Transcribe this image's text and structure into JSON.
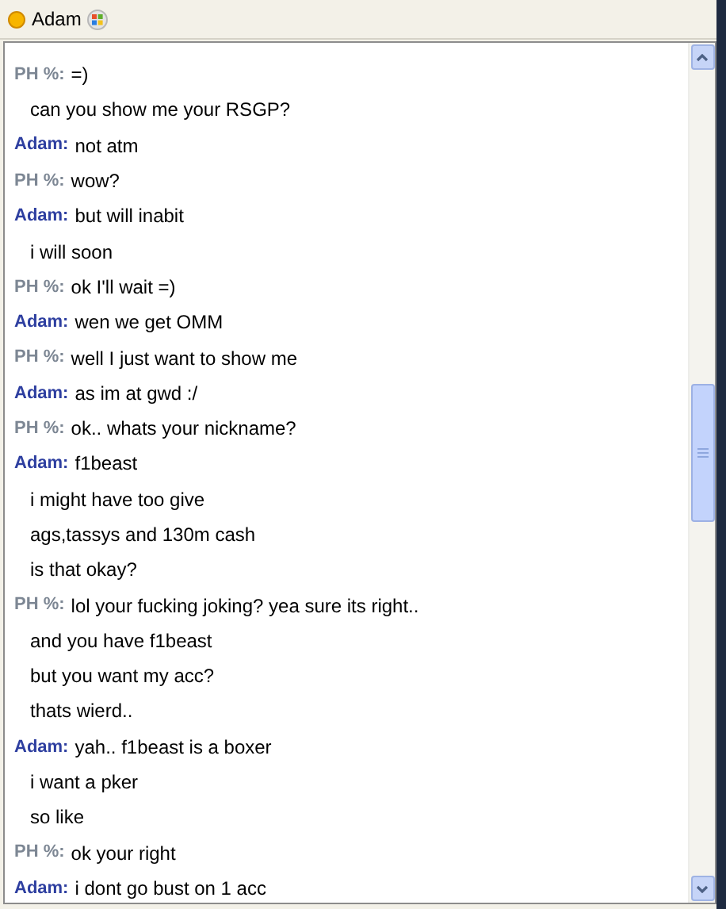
{
  "contact": {
    "name": "Adam"
  },
  "messages": [
    {
      "sender": "PH %:",
      "kind": "other",
      "lines": [
        "=)",
        "can you show me your RSGP?"
      ]
    },
    {
      "sender": "Adam:",
      "kind": "self",
      "lines": [
        "not atm"
      ]
    },
    {
      "sender": "PH %:",
      "kind": "other",
      "lines": [
        "wow?"
      ]
    },
    {
      "sender": "Adam:",
      "kind": "self",
      "lines": [
        "but will inabit",
        "i will soon"
      ]
    },
    {
      "sender": "PH %:",
      "kind": "other",
      "lines": [
        "ok I'll wait =)"
      ]
    },
    {
      "sender": "Adam:",
      "kind": "self",
      "lines": [
        "wen we get OMM"
      ]
    },
    {
      "sender": "PH %:",
      "kind": "other",
      "lines": [
        "well I just want to show me"
      ]
    },
    {
      "sender": "Adam:",
      "kind": "self",
      "lines": [
        "as im at gwd :/"
      ]
    },
    {
      "sender": "PH %:",
      "kind": "other",
      "lines": [
        "ok.. whats your nickname?"
      ]
    },
    {
      "sender": "Adam:",
      "kind": "self",
      "lines": [
        "f1beast",
        "i might have too give",
        "ags,tassys and 130m cash",
        "is that okay?"
      ]
    },
    {
      "sender": "PH %:",
      "kind": "other",
      "lines": [
        "lol your fucking joking? yea sure its right..",
        "and you have f1beast",
        "but you want my acc?",
        "thats wierd.."
      ]
    },
    {
      "sender": "Adam:",
      "kind": "self",
      "lines": [
        "yah.. f1beast is a boxer",
        "i want a pker",
        "so like"
      ]
    },
    {
      "sender": "PH %:",
      "kind": "other",
      "lines": [
        "ok your right"
      ]
    },
    {
      "sender": "Adam:",
      "kind": "self",
      "lines": [
        "i dont go bust on 1 acc"
      ]
    }
  ]
}
